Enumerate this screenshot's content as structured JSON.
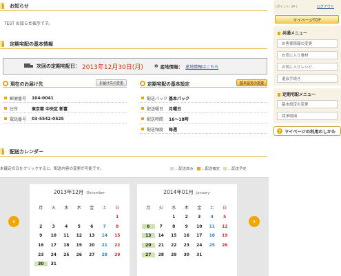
{
  "notice": {
    "title": "お知らせ",
    "text": "TEST お知らせ表示です。"
  },
  "basic_info": {
    "title": "定期宅配の基本情報",
    "next_label": "次回の定期宅配日：",
    "next_date": "2013年12月30日(月)",
    "area_icon": "✽",
    "area_label": "産地情報：",
    "area_link": "産地情報はこちら"
  },
  "address": {
    "title": "現在のお届け先",
    "change_button": "お届け先の変更",
    "rows": [
      {
        "key": "郵便番号",
        "value": "104-0041"
      },
      {
        "key": "住所",
        "value": "東京都 中央区 新富"
      },
      {
        "key": "電話番号",
        "value": "03-5542-0525"
      }
    ]
  },
  "settings": {
    "title": "定期宅配の基本設定",
    "change_button": "基本設定の変更",
    "rows": [
      {
        "key": "配送パック",
        "value": "基本パック"
      },
      {
        "key": "配送曜日",
        "value": "月曜日"
      },
      {
        "key": "配送時間",
        "value": "16～18時"
      },
      {
        "key": "配送頻度",
        "value": "毎週"
      }
    ]
  },
  "calendar": {
    "title": "配送カレンダー",
    "description": "未確定の日をクリックすると、配送内容の変更が可能です。",
    "legend": [
      {
        "label": "…配送済み",
        "color": "#d9d9d9"
      },
      {
        "label": "…配送確定",
        "color": "#f0a800"
      },
      {
        "label": "…配送予定",
        "color": "#cfe3b0"
      }
    ],
    "prev": "‹",
    "next": "›",
    "weekdays": [
      "月",
      "火",
      "水",
      "木",
      "金",
      "土",
      "日"
    ],
    "months": [
      {
        "title": "2013年12月",
        "en": "-December-",
        "weeks": [
          [
            "",
            "",
            "",
            "",
            "",
            "",
            "1"
          ],
          [
            "2",
            "3",
            "4",
            "5",
            "6",
            "7",
            "8"
          ],
          [
            "9",
            "10",
            "11",
            "12",
            "13",
            "14",
            "15"
          ],
          [
            "16",
            "17",
            "18",
            "19",
            "20",
            "21",
            "22"
          ],
          [
            "23",
            "24",
            "25",
            "26",
            "27",
            "28",
            "29"
          ],
          [
            "30",
            "31",
            "",
            "",
            "",
            "",
            ""
          ]
        ],
        "highlight": [
          "30"
        ]
      },
      {
        "title": "2014年01月",
        "en": "-January-",
        "weeks": [
          [
            "",
            "",
            "1",
            "2",
            "3",
            "4",
            "5"
          ],
          [
            "6",
            "7",
            "8",
            "9",
            "10",
            "11",
            "12"
          ],
          [
            "13",
            "14",
            "15",
            "16",
            "17",
            "18",
            "19"
          ],
          [
            "20",
            "21",
            "22",
            "23",
            "24",
            "25",
            "26"
          ],
          [
            "27",
            "28",
            "29",
            "30",
            "31",
            "",
            ""
          ]
        ],
        "highlight": [
          "6",
          "13",
          "20",
          "27"
        ]
      }
    ]
  },
  "sidebar": {
    "points": "[ポイント: 0P ]",
    "logout": "ログアウト",
    "mypage_top": "マイページTOP",
    "common_menu_title": "共通メニュー",
    "common_items": [
      "お客様情報の変更",
      "お気に入り食材",
      "お気に入りレシピ",
      "退会手続き"
    ],
    "regular_menu_title": "定期宅配メニュー",
    "regular_items": [
      "基本設定の変更",
      "請求明細"
    ],
    "help": "マイページの利用のしかた"
  }
}
